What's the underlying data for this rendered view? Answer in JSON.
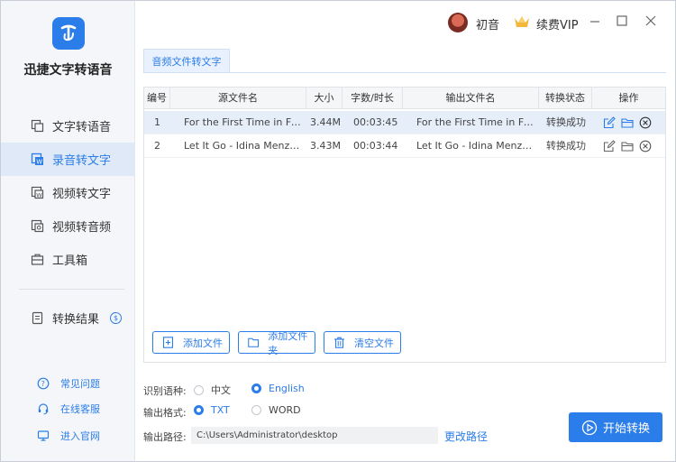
{
  "app": {
    "name": "迅捷文字转语音"
  },
  "user": {
    "name": "初音",
    "vip_label": "续费VIP"
  },
  "sidebar": {
    "items": [
      {
        "label": "文字转语音",
        "icon": "text-to-speech-icon"
      },
      {
        "label": "录音转文字",
        "icon": "audio-to-text-icon",
        "active": true
      },
      {
        "label": "视频转文字",
        "icon": "video-to-text-icon"
      },
      {
        "label": "视频转音频",
        "icon": "video-to-audio-icon"
      },
      {
        "label": "工具箱",
        "icon": "toolbox-icon"
      }
    ],
    "results": {
      "label": "转换结果",
      "badge": "$"
    },
    "links": [
      {
        "label": "常见问题",
        "icon": "question-icon"
      },
      {
        "label": "在线客服",
        "icon": "headset-icon"
      },
      {
        "label": "进入官网",
        "icon": "monitor-icon"
      }
    ]
  },
  "tab": {
    "label": "音频文件转文字"
  },
  "table": {
    "headers": [
      "编号",
      "源文件名",
      "大小",
      "字数/时长",
      "输出文件名",
      "转换状态",
      "操作"
    ],
    "rows": [
      {
        "no": "1",
        "source": "For the First Time in For...",
        "size": "3.44M",
        "duration": "00:03:45",
        "output": "For the First Time in For...",
        "status": "转换成功"
      },
      {
        "no": "2",
        "source": "Let It Go - Idina Menzel...",
        "size": "3.43M",
        "duration": "00:03:44",
        "output": "Let It Go - Idina Menzel...",
        "status": "转换成功"
      }
    ]
  },
  "buttons": {
    "add_file": "添加文件",
    "add_folder": "添加文件夹",
    "clear_files": "清空文件",
    "start": "开始转换"
  },
  "settings": {
    "language_label": "识别语种:",
    "language_options": [
      "中文",
      "English"
    ],
    "language_selected": "English",
    "format_label": "输出格式:",
    "format_options": [
      "TXT",
      "WORD"
    ],
    "format_selected": "TXT",
    "path_label": "输出路径:",
    "path_value": "C:\\Users\\Administrator\\desktop",
    "change_path": "更改路径"
  },
  "colors": {
    "accent": "#2b7de9",
    "sidebar_bg": "#f4f6f9",
    "active_bg": "#dfe9f7"
  }
}
